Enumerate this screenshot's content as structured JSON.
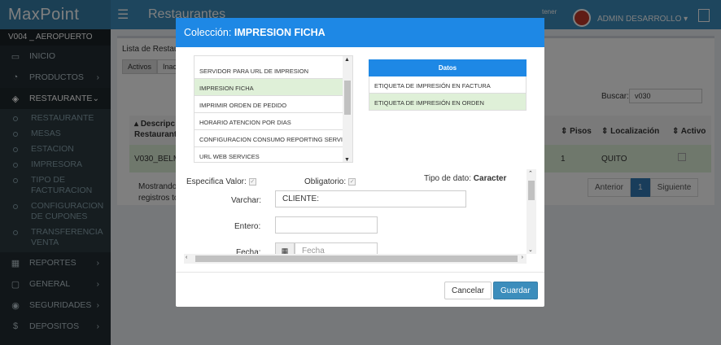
{
  "app": {
    "logo": "MaxPoint",
    "store": "V004 _ AEROPUERTO"
  },
  "sidebar": {
    "items": [
      {
        "label": "INICIO",
        "icon": "monitor-icon"
      },
      {
        "label": "PRODUCTOS",
        "icon": "chart-icon"
      },
      {
        "label": "RESTAURANTE",
        "icon": "layers-icon"
      },
      {
        "label": "REPORTES",
        "icon": "table-icon"
      },
      {
        "label": "GENERAL",
        "icon": "window-icon"
      },
      {
        "label": "SEGURIDADES",
        "icon": "location-icon"
      },
      {
        "label": "DEPOSITOS",
        "icon": "dollar-icon"
      }
    ],
    "submenu": [
      "RESTAURANTE",
      "MESAS",
      "ESTACION",
      "IMPRESORA",
      "TIPO DE FACTURACION",
      "CONFIGURACION DE CUPONES",
      "TRANSFERENCIA VENTA"
    ]
  },
  "header": {
    "title": "Restaurantes",
    "tener": "tener",
    "user": "ADMIN DESARROLLO"
  },
  "main": {
    "list_label": "Lista de Restau",
    "tabs": [
      "Activos",
      "Inacti"
    ],
    "search_label": "Buscar:",
    "search_value": "v030",
    "table": {
      "headers": [
        "Descripc",
        "Restaurant",
        "Pisos",
        "Localización",
        "Activo"
      ],
      "row": {
        "desc": "V030_BELM",
        "pisos": "1",
        "loc": "QUITO"
      }
    },
    "footer_line1": "Mostrando",
    "footer_line2": "registros to",
    "pager": {
      "prev": "Anterior",
      "page": "1",
      "next": "Siguiente"
    }
  },
  "modal": {
    "title_prefix": "Colección:",
    "title": "IMPRESION FICHA",
    "list": [
      "SERVIDOR PARA URL DE IMPRESION",
      "IMPRESION FICHA",
      "IMPRIMIR ORDEN DE PEDIDO",
      "HORARIO ATENCION POR DIAS",
      "CONFIGURACION CONSUMO REPORTING SERVICES",
      "URL WEB SERVICES"
    ],
    "datos": {
      "header": "Datos",
      "rows": [
        "ETIQUETA DE IMPRESIÓN EN FACTURA",
        "ETIQUETA DE IMPRESIÓN EN ORDEN"
      ]
    },
    "form": {
      "especifica": "Especifica Valor:",
      "obligatorio": "Obligatorio:",
      "tipo_label": "Tipo de dato:",
      "tipo_value": "Caracter",
      "varchar_label": "Varchar:",
      "varchar_value": "CLIENTE:",
      "entero_label": "Entero:",
      "fecha_label": "Fecha:",
      "fecha_placeholder": "Fecha"
    },
    "buttons": {
      "cancel": "Cancelar",
      "save": "Guardar"
    }
  },
  "colors": {
    "accent": "#1e88e5",
    "header": "#3c8dbc",
    "sidebar": "#222d32",
    "selected": "#dff0d8"
  }
}
